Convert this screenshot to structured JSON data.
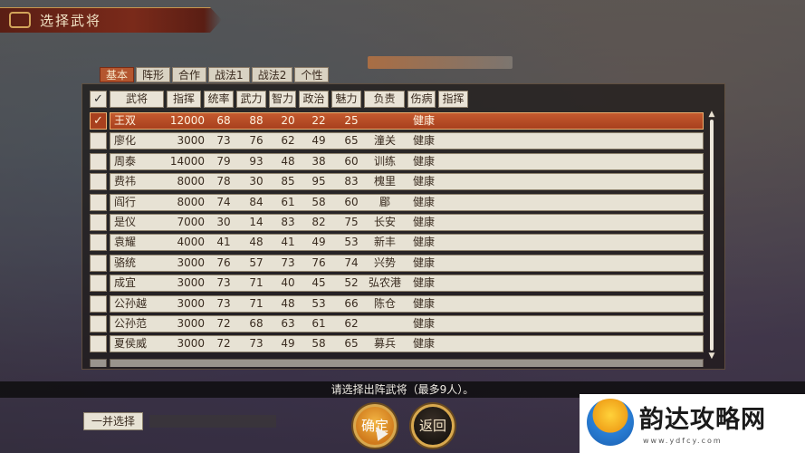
{
  "title": "选择武将",
  "tabs": [
    "基本",
    "阵形",
    "合作",
    "战法1",
    "战法2",
    "个性"
  ],
  "active_tab": 0,
  "columns": [
    "武将",
    "指挥",
    "统率",
    "武力",
    "智力",
    "政治",
    "魅力",
    "负责",
    "伤病",
    "指挥"
  ],
  "header_check": "✓",
  "rows": [
    {
      "name": "王双",
      "cmd": "12000",
      "lead": "68",
      "war": "88",
      "int": "20",
      "pol": "22",
      "cha": "25",
      "duty": "",
      "inj": "健康",
      "selected": true,
      "check": "✓"
    },
    {
      "name": "廖化",
      "cmd": "3000",
      "lead": "73",
      "war": "76",
      "int": "62",
      "pol": "49",
      "cha": "65",
      "duty": "潼关",
      "inj": "健康"
    },
    {
      "name": "周泰",
      "cmd": "14000",
      "lead": "79",
      "war": "93",
      "int": "48",
      "pol": "38",
      "cha": "60",
      "duty": "训练",
      "inj": "健康"
    },
    {
      "name": "费祎",
      "cmd": "8000",
      "lead": "78",
      "war": "30",
      "int": "85",
      "pol": "95",
      "cha": "83",
      "duty": "槐里",
      "inj": "健康"
    },
    {
      "name": "阎行",
      "cmd": "8000",
      "lead": "74",
      "war": "84",
      "int": "61",
      "pol": "58",
      "cha": "60",
      "duty": "郿",
      "inj": "健康"
    },
    {
      "name": "是仪",
      "cmd": "7000",
      "lead": "30",
      "war": "14",
      "int": "83",
      "pol": "82",
      "cha": "75",
      "duty": "长安",
      "inj": "健康"
    },
    {
      "name": "袁耀",
      "cmd": "4000",
      "lead": "41",
      "war": "48",
      "int": "41",
      "pol": "49",
      "cha": "53",
      "duty": "新丰",
      "inj": "健康"
    },
    {
      "name": "骆统",
      "cmd": "3000",
      "lead": "76",
      "war": "57",
      "int": "73",
      "pol": "76",
      "cha": "74",
      "duty": "兴势",
      "inj": "健康"
    },
    {
      "name": "成宜",
      "cmd": "3000",
      "lead": "73",
      "war": "71",
      "int": "40",
      "pol": "45",
      "cha": "52",
      "duty": "弘农港",
      "inj": "健康"
    },
    {
      "name": "公孙越",
      "cmd": "3000",
      "lead": "73",
      "war": "71",
      "int": "48",
      "pol": "53",
      "cha": "66",
      "duty": "陈仓",
      "inj": "健康"
    },
    {
      "name": "公孙范",
      "cmd": "3000",
      "lead": "72",
      "war": "68",
      "int": "63",
      "pol": "61",
      "cha": "62",
      "duty": "",
      "inj": "健康"
    },
    {
      "name": "夏侯威",
      "cmd": "3000",
      "lead": "72",
      "war": "73",
      "int": "49",
      "pol": "58",
      "cha": "65",
      "duty": "募兵",
      "inj": "健康"
    }
  ],
  "status": "请选择出阵武将（最多9人）。",
  "buttons": {
    "select_all": "一并选择",
    "confirm": "确定",
    "back": "返回"
  },
  "watermark": {
    "text": "韵达攻略网",
    "url": "www.ydfcy.com"
  },
  "scroll": {
    "up": "▲",
    "down": "▼"
  }
}
